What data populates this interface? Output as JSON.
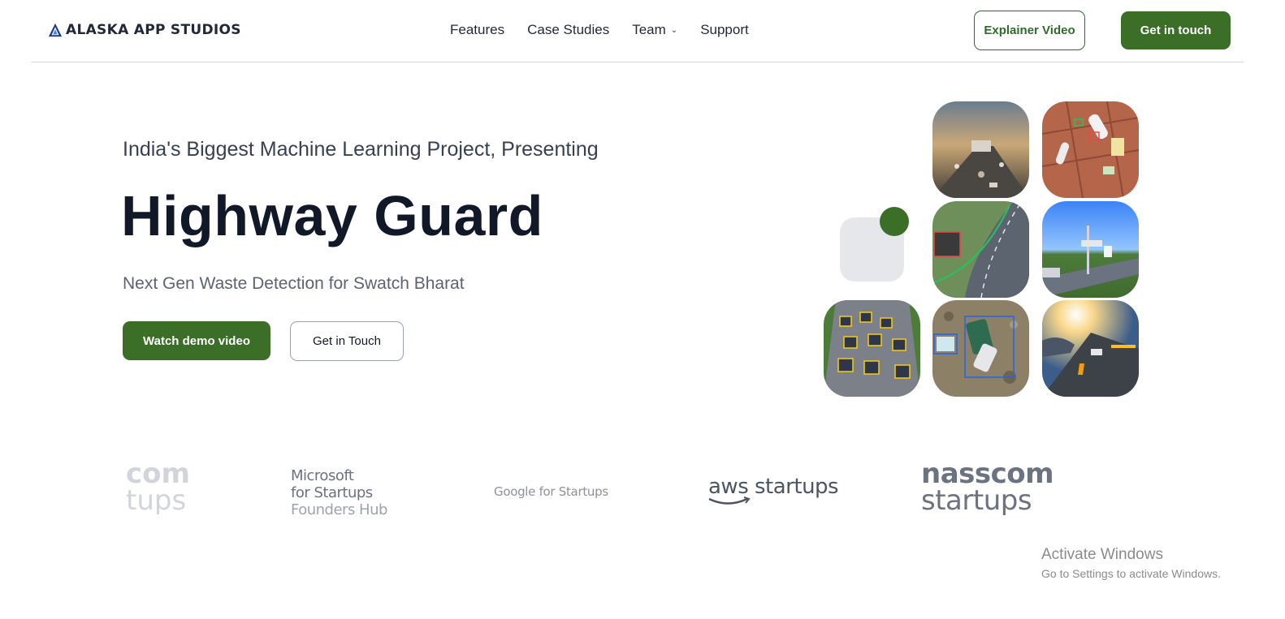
{
  "header": {
    "brand": "ALASKA APP STUDIOS",
    "nav": [
      {
        "label": "Features"
      },
      {
        "label": "Case Studies"
      },
      {
        "label": "Team",
        "has_dropdown": true
      },
      {
        "label": "Support"
      }
    ],
    "explainer_label": "Explainer Video",
    "contact_label": "Get in touch"
  },
  "hero": {
    "eyebrow": "India's Biggest Machine Learning Project, Presenting",
    "title": "Highway Guard",
    "subtitle": "Next Gen Waste Detection for Swatch Bharat",
    "primary_cta": "Watch demo video",
    "secondary_cta": "Get in Touch"
  },
  "partners": {
    "faded_top": "com",
    "faded_bottom": "tups",
    "microsoft": [
      "Microsoft",
      "for Startups",
      "Founders Hub"
    ],
    "google": "Google for Startups",
    "aws": "aws startups",
    "nasscom_top": "nasscom",
    "nasscom_bottom": "startups"
  },
  "watermark": {
    "title": "Activate Windows",
    "subtitle": "Go to Settings to activate Windows."
  },
  "colors": {
    "brand_green": "#3b6e26",
    "text_dark": "#111827",
    "grey_tile": "#e5e7eb"
  }
}
